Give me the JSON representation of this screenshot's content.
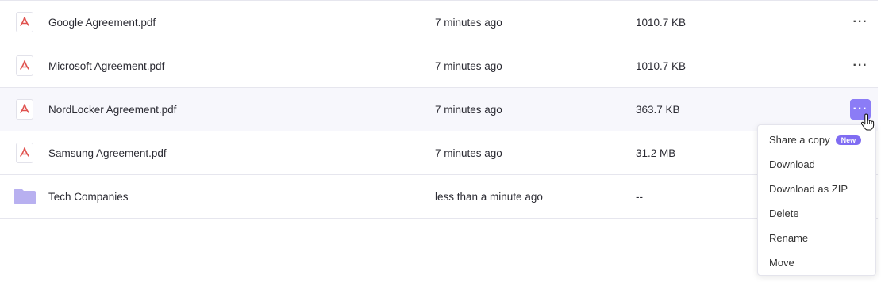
{
  "files": [
    {
      "name": "Google Agreement.pdf",
      "modified": "7 minutes ago",
      "size": "1010.7 KB",
      "type_icon": "pdf-icon"
    },
    {
      "name": "Microsoft Agreement.pdf",
      "modified": "7 minutes ago",
      "size": "1010.7 KB",
      "type_icon": "pdf-icon"
    },
    {
      "name": "NordLocker Agreement.pdf",
      "modified": "7 minutes ago",
      "size": "363.7 KB",
      "type_icon": "pdf-icon"
    },
    {
      "name": "Samsung Agreement.pdf",
      "modified": "7 minutes ago",
      "size": "31.2 MB",
      "type_icon": "pdf-icon"
    },
    {
      "name": "Tech Companies",
      "modified": "less than a minute ago",
      "size": "--",
      "type_icon": "folder-icon"
    }
  ],
  "more_button_label": "···",
  "context_menu": {
    "items": [
      "Share a copy",
      "Download",
      "Download as ZIP",
      "Delete",
      "Rename",
      "Move"
    ],
    "new_badge": "New"
  },
  "colors": {
    "accent": "#8b7cf6",
    "badge": "#7f6cf2",
    "pdf_red": "#e0524f",
    "folder": "#b8b0f0",
    "row_highlight": "#f7f7fc",
    "divider": "#e6e6ee"
  }
}
